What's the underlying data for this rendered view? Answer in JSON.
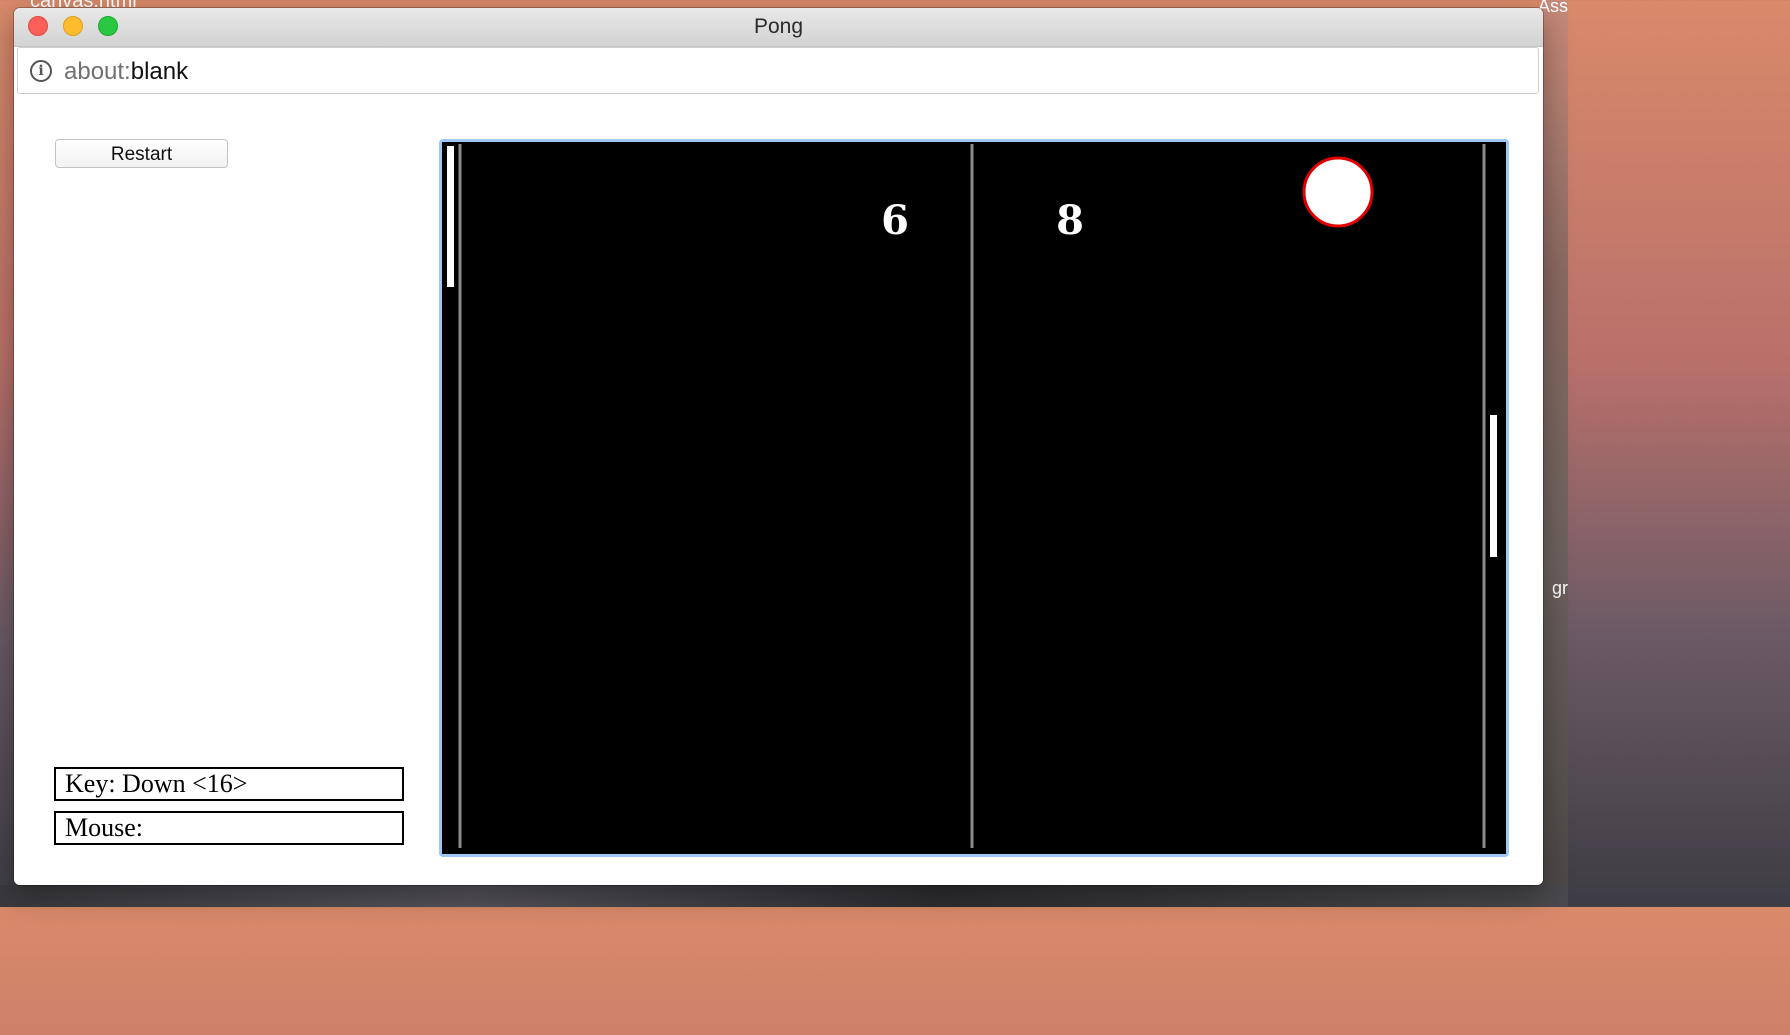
{
  "desktop": {
    "label_top": "canvas.html",
    "label_right_top": "Ass",
    "label_right_mid": "gr"
  },
  "window": {
    "title": "Pong"
  },
  "addressbar": {
    "url_scheme": "about:",
    "url_rest": "blank"
  },
  "controls": {
    "restart_label": "Restart"
  },
  "status": {
    "key_text": "Key: Down <16>",
    "mouse_text": "Mouse: "
  },
  "game": {
    "score_left": "6",
    "score_right": "8",
    "colors": {
      "background": "#000000",
      "lines": "#8a8a8a",
      "paddle": "#ffffff",
      "ball_fill": "#ffffff",
      "ball_stroke": "#e00000"
    }
  }
}
